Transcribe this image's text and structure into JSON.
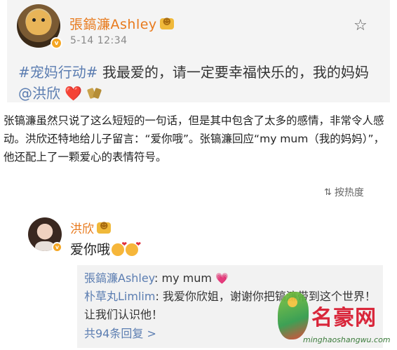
{
  "post": {
    "username": "張鎬濂Ashley",
    "verified_badge": "v",
    "timestamp": "5-14 12:34",
    "topic": "#宠妈行动#",
    "text": " 我最爱的，请一定要幸福快乐的，我的妈妈 ",
    "mention": "@洪欣",
    "heart": "❤️",
    "icons": {
      "star": "star-icon",
      "clink": "beer-clink-icon"
    }
  },
  "article": {
    "paragraph": "张镐濂虽然只说了这么短短的一句话，但是其中包含了太多的感情，非常令人感动。洪欣还特地给儿子留言：“爱你哦”。张镐濂回应“my mum（我的妈妈）”，他还配上了一颗爱心的表情符号。"
  },
  "sort": {
    "icon": "⇅",
    "label": "按热度"
  },
  "comment": {
    "username": "洪欣",
    "verified_badge": "v",
    "text": "爱你哦",
    "replies": [
      {
        "user": "張鎬濂Ashley",
        "text": ": my mum ",
        "emoji": "💗"
      },
      {
        "user": "朴草丸Limlim",
        "text": ": 我爱你欣姐，谢谢你把镐濂带到这个世界！让我们认识他！"
      }
    ],
    "reply_count": "共94条回复 >"
  },
  "watermark": {
    "title": "名豪网",
    "url": "minghaoshangwu.com"
  },
  "colors": {
    "link": "#5b7db1",
    "username": "#e87a1d",
    "heart": "#e0313b",
    "card_bg": "#f4f4f4"
  }
}
